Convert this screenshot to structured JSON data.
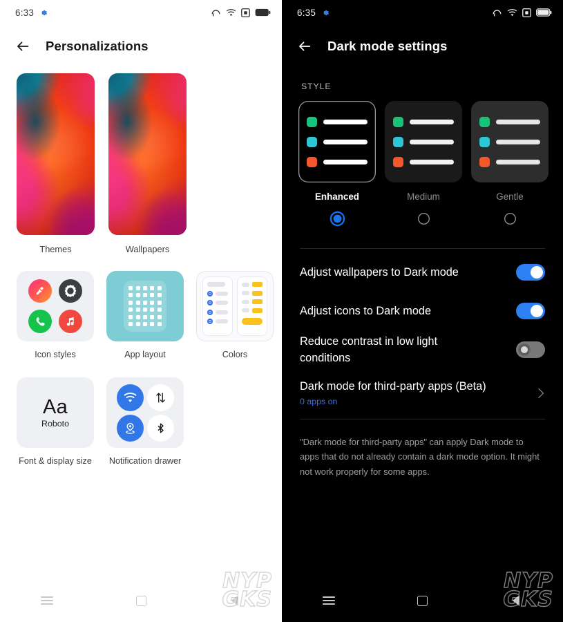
{
  "left_phone": {
    "status_bar": {
      "time": "6:33",
      "icons": [
        "gear-icon",
        "headphone-icon",
        "wifi-icon",
        "screen-record-icon",
        "battery-icon"
      ]
    },
    "app_bar": {
      "back": "back-arrow-icon",
      "title": "Personalizations"
    },
    "wallpaper_cards": [
      {
        "label": "Themes"
      },
      {
        "label": "Wallpapers"
      }
    ],
    "tiles_row_1": [
      {
        "label": "Icon styles",
        "icons": [
          "theme-brush-icon",
          "gear-icon",
          "phone-icon",
          "music-icon"
        ]
      },
      {
        "label": "App layout"
      },
      {
        "label": "Colors"
      }
    ],
    "tiles_row_2": [
      {
        "label": "Font & display size",
        "sample": "Aa",
        "font_name": "Roboto"
      },
      {
        "label": "Notification drawer",
        "icons": [
          "wifi-icon",
          "data-transfer-icon",
          "location-icon",
          "bluetooth-icon"
        ]
      }
    ],
    "nav_bar": [
      "recents-icon",
      "home-icon",
      "back-icon"
    ],
    "watermark": {
      "line1": "NYP",
      "line2": "GKS"
    }
  },
  "right_phone": {
    "status_bar": {
      "time": "6:35",
      "icons": [
        "gear-icon",
        "headphone-icon",
        "wifi-icon",
        "screen-record-icon",
        "battery-icon"
      ]
    },
    "app_bar": {
      "back": "back-arrow-icon",
      "title": "Dark mode settings"
    },
    "style_section": {
      "header": "STYLE",
      "options": [
        {
          "name": "Enhanced",
          "selected": true
        },
        {
          "name": "Medium",
          "selected": false
        },
        {
          "name": "Gentle",
          "selected": false
        }
      ],
      "swatch_colors": [
        "#19c27a",
        "#2ec6d6",
        "#f4572a"
      ]
    },
    "toggles": [
      {
        "label": "Adjust wallpapers to Dark mode",
        "state": "on"
      },
      {
        "label": "Adjust icons to Dark mode",
        "state": "on"
      },
      {
        "label": "Reduce contrast in low light conditions",
        "state": "off"
      }
    ],
    "third_party": {
      "title": "Dark mode for third-party apps (Beta)",
      "subtitle": "0 apps on",
      "chevron": "chevron-right-icon"
    },
    "footnote": "\"Dark mode for third-party apps\" can apply Dark mode to apps that do not already contain a dark mode option. It might not work properly for some apps.",
    "nav_bar": [
      "recents-icon",
      "home-icon",
      "back-icon"
    ],
    "watermark": {
      "line1": "NYP",
      "line2": "GKS"
    }
  },
  "colors": {
    "accent_blue": "#2d7ff2",
    "link_blue": "#3f6fd8",
    "teal_tile": "#7fcdd4",
    "yellow": "#fcc21b"
  }
}
